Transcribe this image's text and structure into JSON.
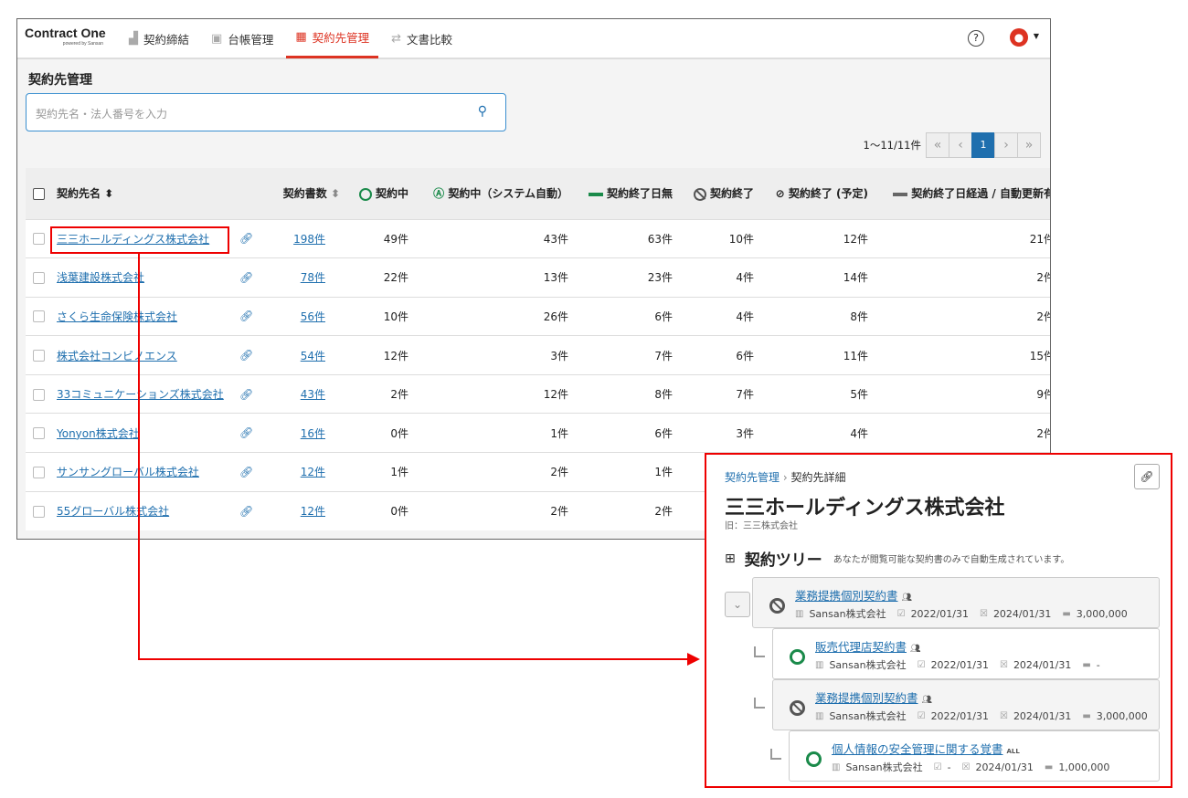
{
  "nav": {
    "logo": "Contract One",
    "logo_sub": "powered by Sansan",
    "tabs": [
      {
        "label": "契約締結",
        "icon": "stamp-icon"
      },
      {
        "label": "台帳管理",
        "icon": "ledger-icon"
      },
      {
        "label": "契約先管理",
        "icon": "building-icon",
        "active": true
      },
      {
        "label": "文書比較",
        "icon": "compare-arrows-icon"
      }
    ],
    "help": "?"
  },
  "page": {
    "title": "契約先管理",
    "search_placeholder": "契約先名・法人番号を入力"
  },
  "pager": {
    "range": "1〜11/11件",
    "current": "1"
  },
  "table": {
    "headers": [
      "契約先名",
      "契約書数",
      "契約中",
      "契約中（システム自動）",
      "契約終了日無",
      "契約終了",
      "契約終了 (予定)",
      "契約終了日経過 / 自動更新有"
    ],
    "rows": [
      [
        "三三ホールディングス株式会社",
        "198件",
        "49件",
        "43件",
        "63件",
        "10件",
        "12件",
        "21件"
      ],
      [
        "浅葉建設株式会社",
        "78件",
        "22件",
        "13件",
        "23件",
        "4件",
        "14件",
        "2件"
      ],
      [
        "さくら生命保険株式会社",
        "56件",
        "10件",
        "26件",
        "6件",
        "4件",
        "8件",
        "2件"
      ],
      [
        "株式会社コンビノエンス",
        "54件",
        "12件",
        "3件",
        "7件",
        "6件",
        "11件",
        "15件"
      ],
      [
        "33コミュニケーションズ株式会社",
        "43件",
        "2件",
        "12件",
        "8件",
        "7件",
        "5件",
        "9件"
      ],
      [
        "Yonyon株式会社",
        "16件",
        "0件",
        "1件",
        "6件",
        "3件",
        "4件",
        "2件"
      ],
      [
        "サンサングローバル株式会社",
        "12件",
        "1件",
        "2件",
        "1件",
        "",
        "",
        ""
      ],
      [
        "55グローバル株式会社",
        "12件",
        "0件",
        "2件",
        "2件",
        "",
        "",
        ""
      ]
    ]
  },
  "detail": {
    "breadcrumb": [
      "契約先管理",
      "契約先詳細"
    ],
    "title": "三三ホールディングス株式会社",
    "former": "旧：三三株式会社",
    "tree_title": "契約ツリー",
    "tree_note": "あなたが閲覧可能な契約書のみで自動生成されています。",
    "nodes": [
      {
        "title": "業務提携個別契約書",
        "status": "terminated",
        "badge": "people",
        "company": "Sansan株式会社",
        "start": "2022/01/31",
        "end": "2024/01/31",
        "amount": "3,000,000"
      },
      {
        "title": "販売代理店契約書",
        "status": "active",
        "badge": "people",
        "company": "Sansan株式会社",
        "start": "2022/01/31",
        "end": "2024/01/31",
        "amount": "-"
      },
      {
        "title": "業務提携個別契約書",
        "status": "terminated",
        "badge": "people",
        "company": "Sansan株式会社",
        "start": "2022/01/31",
        "end": "2024/01/31",
        "amount": "3,000,000"
      },
      {
        "title": "個人情報の安全管理に関する覚書",
        "status": "active",
        "badge": "ALL",
        "company": "Sansan株式会社",
        "start": "-",
        "end": "2024/01/31",
        "amount": "1,000,000"
      }
    ]
  },
  "colors": {
    "accent": "#d32f2f",
    "link": "#1f6fae",
    "active": "#1a8a4a",
    "highlight": "#ee0000"
  }
}
